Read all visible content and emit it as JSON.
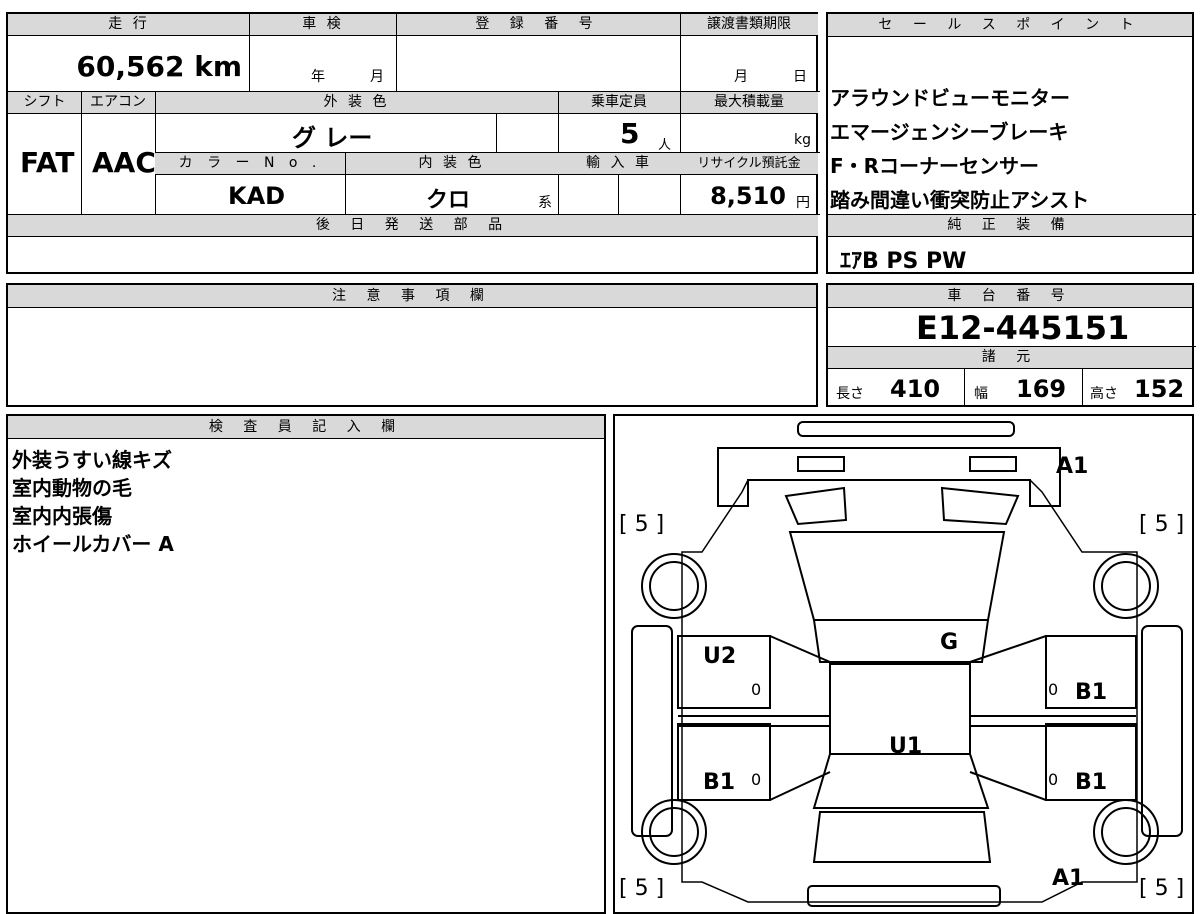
{
  "top": {
    "mileage_label": "走 行",
    "mileage": "60,562 km",
    "inspection_label": "車 検",
    "inspection_year": "年",
    "inspection_month": "月",
    "registration_label": "登 録 番 号",
    "registration": "",
    "transfer_label": "譲渡書類期限",
    "transfer_month": "月",
    "transfer_day": "日",
    "shift_label": "シフト",
    "shift": "FAT",
    "ac_label": "エアコン",
    "ac": "AAC",
    "ext_color_label": "外 装 色",
    "ext_color": "グ レー",
    "capacity_label": "乗車定員",
    "capacity": "5",
    "capacity_unit": "人",
    "max_load_label": "最大積載量",
    "max_load_unit": "kg",
    "color_no_label": "カ ラ ー N o .",
    "color_no": "KAD",
    "int_color_label": "内 装 色",
    "int_color": "クロ",
    "int_color_suffix": "系",
    "import_label": "輸 入 車",
    "recycle_label": "リサイクル預託金",
    "recycle": "8,510",
    "recycle_unit": "円",
    "later_parts_label": "後 日 発 送 部 品"
  },
  "sales": {
    "label": "セ ー ル ス ポ イ ン ト",
    "points": [
      "アラウンドビューモニター",
      "エマージェンシーブレーキ",
      "F・Rコーナーセンサー",
      "踏み間違い衝突防止アシスト"
    ]
  },
  "genuine": {
    "label": "純 正 装 備",
    "value": "ｴｱB PS PW"
  },
  "notes": {
    "label": "注 意 事 項 欄"
  },
  "chassis": {
    "label": "車 台 番 号",
    "value": "E12-445151",
    "specs_label": "諸 元",
    "length_label": "長さ",
    "length": "410",
    "width_label": "幅",
    "width": "169",
    "height_label": "高さ",
    "height": "152"
  },
  "inspector": {
    "label": "検 査 員 記 入 欄",
    "lines": [
      "外装うすい線キズ",
      "室内動物の毛",
      "室内内張傷",
      "ホイールカバー A"
    ]
  },
  "diagram": {
    "tire_fl": "[ 5 ]",
    "tire_fr": "[ 5 ]",
    "tire_rl": "[ 5 ]",
    "tire_rr": "[ 5 ]",
    "a1_front": "A1",
    "g": "G",
    "u2": "U2",
    "b1_rf": "B1",
    "u1": "U1",
    "b1_lr": "B1",
    "b1_rr": "B1",
    "a1_rear": "A1",
    "zero_1": "0",
    "zero_2": "0",
    "zero_3": "0",
    "zero_4": "0"
  }
}
